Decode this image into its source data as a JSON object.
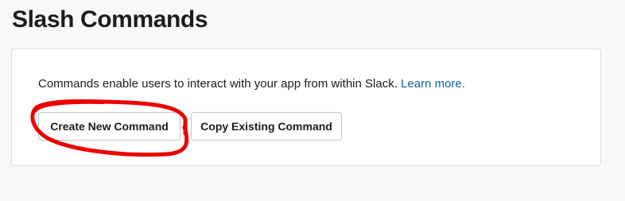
{
  "page": {
    "title": "Slash Commands"
  },
  "card": {
    "description": "Commands enable users to interact with your app from within Slack.",
    "learn_more_label": "Learn more."
  },
  "buttons": {
    "create_new": "Create New Command",
    "copy_existing": "Copy Existing Command"
  },
  "colors": {
    "link": "#1264a3",
    "annotation": "#ee0000"
  }
}
